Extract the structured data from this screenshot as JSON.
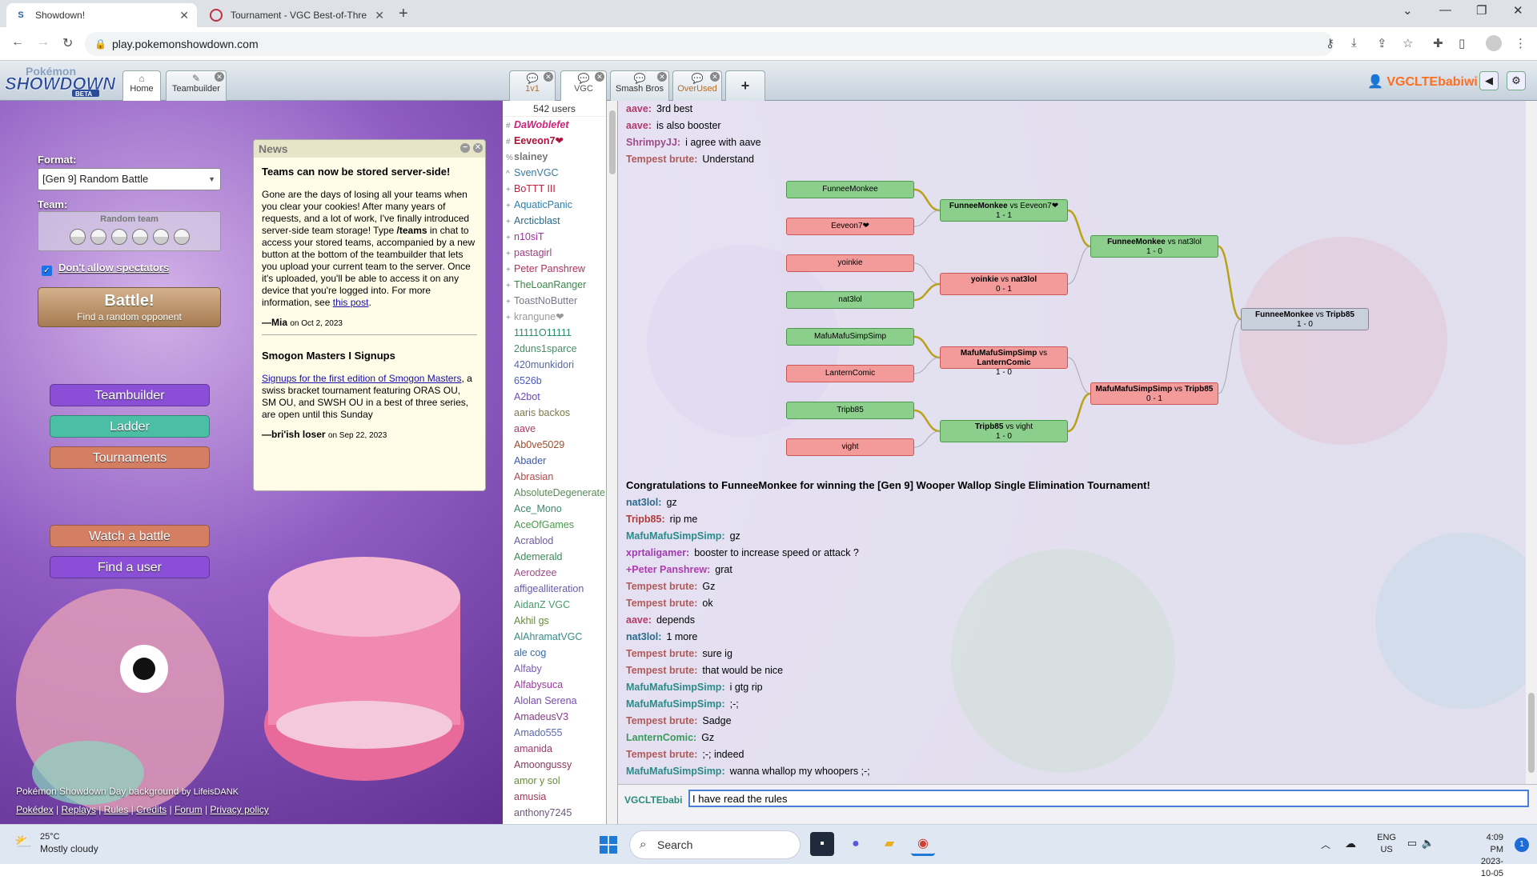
{
  "browser": {
    "tabs": [
      {
        "title": "Showdown!",
        "active": true
      },
      {
        "title": "Tournament - VGC Best-of-Three",
        "active": false
      }
    ],
    "url": "play.pokemonshowdown.com"
  },
  "header": {
    "logo_top": "Pokémon",
    "logo_main": "SHOWDOWN",
    "logo_beta": "BETA",
    "tabs": [
      {
        "label": "Home",
        "icon": "home-icon"
      },
      {
        "label": "Teambuilder",
        "icon": "pencil-icon"
      }
    ],
    "room_tabs": [
      {
        "label": "1v1"
      },
      {
        "label": "VGC"
      },
      {
        "label": "Smash Bros"
      },
      {
        "label": "OverUsed"
      }
    ],
    "add_tab": "+",
    "username": "VGCLTEbabiwi"
  },
  "mainmenu": {
    "format_label": "Format:",
    "format_value": "[Gen 9] Random Battle",
    "team_label": "Team:",
    "team_value": "Random team",
    "spectators_label": "Don't allow spectators",
    "battle_title": "Battle!",
    "battle_sub": "Find a random opponent",
    "teambuilder": "Teambuilder",
    "ladder": "Ladder",
    "tournaments": "Tournaments",
    "watch": "Watch a battle",
    "find_user": "Find a user",
    "colors": {
      "teambuilder": "#8a4fd6",
      "ladder": "#4bbfa6",
      "tournaments": "#d47e63",
      "watch": "#d47e63",
      "find_user": "#8a4fd6"
    }
  },
  "footer": {
    "credit_prefix": "Pokémon Showdown Day background",
    "credit_by": "by",
    "credit_name": "LifeisDANK",
    "links": [
      "Pokédex",
      "Replays",
      "Rules",
      "Credits",
      "Forum",
      "Privacy policy"
    ]
  },
  "news": {
    "title": "News",
    "items": [
      {
        "heading": "Teams can now be stored server-side!",
        "p1": "Gone are the days of losing all your teams when you clear your cookies! After many years of requests, and a lot of work, I've finally introduced server-side team storage! Type",
        "cmd": "/teams",
        "p2": "in chat to access your stored teams, accompanied by a new button at the bottom of the teambuilder that lets you upload your current team to the server. Once it's uploaded, you'll be able to access it on any device that you're logged into. For more information, see",
        "link": "this post",
        "author": "—Mia",
        "date": "on Oct 2, 2023"
      },
      {
        "heading": "Smogon Masters I Signups",
        "link": "Signups for the first edition of Smogon Masters",
        "p1": ", a swiss bracket tournament featuring ORAS OU, SM OU, and SWSH OU in a best of three series, are open until this Sunday",
        "author": "—bri'ish loser",
        "date": "on Sep 22, 2023"
      }
    ]
  },
  "userlist": {
    "count": "542 users",
    "users": [
      {
        "g": "#",
        "name": "DaWoblefet",
        "color": "#d0207a",
        "style": "bi"
      },
      {
        "g": "#",
        "name": "Eeveon7❤",
        "color": "#b0103a",
        "style": "b"
      },
      {
        "g": "%",
        "name": "slainey",
        "color": "#777",
        "style": "b"
      },
      {
        "g": "^",
        "name": "SvenVGC",
        "color": "#3a7aa0",
        "style": ""
      },
      {
        "g": "+",
        "name": "BoTTT III",
        "color": "#c02040",
        "style": ""
      },
      {
        "g": "+",
        "name": "AquaticPanic",
        "color": "#2a80b0",
        "style": ""
      },
      {
        "g": "+",
        "name": "Arcticblast",
        "color": "#2a6a8a",
        "style": ""
      },
      {
        "g": "+",
        "name": "n10siT",
        "color": "#a030a0",
        "style": ""
      },
      {
        "g": "+",
        "name": "pastagirl",
        "color": "#a04080",
        "style": ""
      },
      {
        "g": "+",
        "name": "Peter Panshrew",
        "color": "#b03060",
        "style": ""
      },
      {
        "g": "+",
        "name": "TheLoanRanger",
        "color": "#3a8a4a",
        "style": ""
      },
      {
        "g": "+",
        "name": "ToastNoButter",
        "color": "#778",
        "style": ""
      },
      {
        "g": "+",
        "name": "krangune❤",
        "color": "#999",
        "style": ""
      },
      {
        "g": "",
        "name": "11111O11111",
        "color": "#2a8a6a",
        "style": ""
      },
      {
        "g": "",
        "name": "2duns1sparce",
        "color": "#4a8a6a",
        "style": ""
      },
      {
        "g": "",
        "name": "420munkidori",
        "color": "#5a6aa0",
        "style": ""
      },
      {
        "g": "",
        "name": "6526b",
        "color": "#4a5ac0",
        "style": ""
      },
      {
        "g": "",
        "name": "A2bot",
        "color": "#6a4ac0",
        "style": ""
      },
      {
        "g": "",
        "name": "aaris backos",
        "color": "#7a7a4a",
        "style": ""
      },
      {
        "g": "",
        "name": "aave",
        "color": "#b03a6a",
        "style": ""
      },
      {
        "g": "",
        "name": "Ab0ve5029",
        "color": "#a04a2a",
        "style": ""
      },
      {
        "g": "",
        "name": "Abader",
        "color": "#3a5ab0",
        "style": ""
      },
      {
        "g": "",
        "name": "Abrasian",
        "color": "#b04a4a",
        "style": ""
      },
      {
        "g": "",
        "name": "AbsoluteDegenerate",
        "color": "#5a8a5a",
        "style": ""
      },
      {
        "g": "",
        "name": "Ace_Mono",
        "color": "#3a8a6a",
        "style": ""
      },
      {
        "g": "",
        "name": "AceOfGames",
        "color": "#4a9a4a",
        "style": ""
      },
      {
        "g": "",
        "name": "Acrablod",
        "color": "#6a5aa0",
        "style": ""
      },
      {
        "g": "",
        "name": "Ademerald",
        "color": "#3a8a5a",
        "style": ""
      },
      {
        "g": "",
        "name": "Aerodzee",
        "color": "#a04a8a",
        "style": ""
      },
      {
        "g": "",
        "name": "affigealliteration",
        "color": "#6a5ab0",
        "style": ""
      },
      {
        "g": "",
        "name": "AidanZ VGC",
        "color": "#4a9a6a",
        "style": ""
      },
      {
        "g": "",
        "name": "Akhil gs",
        "color": "#6a8a3a",
        "style": ""
      },
      {
        "g": "",
        "name": "AlAhramatVGC",
        "color": "#3a8a8a",
        "style": ""
      },
      {
        "g": "",
        "name": "ale cog",
        "color": "#3a6ab0",
        "style": ""
      },
      {
        "g": "",
        "name": "Alfaby",
        "color": "#7a5ab0",
        "style": ""
      },
      {
        "g": "",
        "name": "Alfabysuca",
        "color": "#9a3aa0",
        "style": ""
      },
      {
        "g": "",
        "name": "Alolan Serena",
        "color": "#7a4ab0",
        "style": ""
      },
      {
        "g": "",
        "name": "AmadeusV3",
        "color": "#8a3a8a",
        "style": ""
      },
      {
        "g": "",
        "name": "Amado555",
        "color": "#5a6ab0",
        "style": ""
      },
      {
        "g": "",
        "name": "amanida",
        "color": "#a03a6a",
        "style": ""
      },
      {
        "g": "",
        "name": "Amoongussy",
        "color": "#8a3a5a",
        "style": ""
      },
      {
        "g": "",
        "name": "amor y sol",
        "color": "#6a8a3a",
        "style": ""
      },
      {
        "g": "",
        "name": "amusia",
        "color": "#a03a5a",
        "style": ""
      },
      {
        "g": "",
        "name": "anthony7245",
        "color": "#6a5a7a",
        "style": ""
      }
    ]
  },
  "chat_top": [
    {
      "user": "aave:",
      "color": "#b03a6a",
      "msg": "3rd best"
    },
    {
      "user": "aave:",
      "color": "#b03a6a",
      "msg": "is also booster"
    },
    {
      "user": "ShrimpyJJ:",
      "color": "#a04a8a",
      "msg": "i agree with aave"
    },
    {
      "user": "Tempest brute:",
      "color": "#b05a5a",
      "msg": "Understand"
    }
  ],
  "bracket": {
    "players": [
      {
        "name": "FunneeMonkee",
        "result": "w"
      },
      {
        "name": "Eeveon7❤",
        "result": "l"
      },
      {
        "name": "yoinkie",
        "result": "l"
      },
      {
        "name": "nat3lol",
        "result": "w"
      },
      {
        "name": "MafuMafuSimpSimp",
        "result": "w"
      },
      {
        "name": "LanternComic",
        "result": "l"
      },
      {
        "name": "Tripb85",
        "result": "w"
      },
      {
        "name": "vight",
        "result": "l"
      }
    ],
    "r1": [
      {
        "a": "FunneeMonkee",
        "vs": "vs",
        "b": "Eeveon7❤",
        "score": "1 - 1",
        "result": "w"
      },
      {
        "a": "yoinkie",
        "vs": "vs",
        "b": "nat3lol",
        "score": "0 - 1",
        "result": "l"
      },
      {
        "a": "MafuMafuSimpSimp",
        "vs": "vs",
        "b": "LanternComic",
        "score": "1 - 0",
        "result": "l"
      },
      {
        "a": "Tripb85",
        "vs": "vs",
        "b": "vight",
        "score": "1 - 0",
        "result": "w"
      }
    ],
    "r2": [
      {
        "a": "FunneeMonkee",
        "vs": "vs",
        "b": "nat3lol",
        "score": "1 - 0",
        "result": "w"
      },
      {
        "a": "MafuMafuSimpSimp",
        "vs": "vs",
        "b": "Tripb85",
        "score": "0 - 1",
        "result": "l"
      }
    ],
    "final": {
      "a": "FunneeMonkee",
      "vs": "vs",
      "b": "Tripb85",
      "score": "1 - 0",
      "result": "n"
    },
    "colors": {
      "win": "#8ccf8c",
      "loss": "#f39a9a",
      "line": "#b8a21a"
    }
  },
  "congrats": "Congratulations to FunneeMonkee for winning the [Gen 9] Wooper Wallop Single Elimination Tournament!",
  "chat_bottom": [
    {
      "user": "nat3lol:",
      "color": "#2a6a8a",
      "msg": "gz"
    },
    {
      "user": "Tripb85:",
      "color": "#b03a3a",
      "msg": "rip me"
    },
    {
      "user": "MafuMafuSimpSimp:",
      "color": "#2a8a8a",
      "msg": "gz"
    },
    {
      "user": "xprtaligamer:",
      "color": "#a03ab0",
      "msg": "booster to increase speed or attack ?"
    },
    {
      "user": "+Peter Panshrew:",
      "color": "#b03ab0",
      "msg": "grat"
    },
    {
      "user": "Tempest brute:",
      "color": "#b05a5a",
      "msg": "Gz"
    },
    {
      "user": "Tempest brute:",
      "color": "#b05a5a",
      "msg": "ok"
    },
    {
      "user": "aave:",
      "color": "#b03a6a",
      "msg": "depends"
    },
    {
      "user": "nat3lol:",
      "color": "#2a6a8a",
      "msg": "1 more"
    },
    {
      "user": "Tempest brute:",
      "color": "#b05a5a",
      "msg": "sure ig"
    },
    {
      "user": "Tempest brute:",
      "color": "#b05a5a",
      "msg": "that would be nice"
    },
    {
      "user": "MafuMafuSimpSimp:",
      "color": "#2a8a8a",
      "msg": "i gtg rip"
    },
    {
      "user": "MafuMafuSimpSimp:",
      "color": "#2a8a8a",
      "msg": ";-;"
    },
    {
      "user": "Tempest brute:",
      "color": "#b05a5a",
      "msg": "Sadge"
    },
    {
      "user": "LanternComic:",
      "color": "#3a9a5a",
      "msg": "Gz"
    },
    {
      "user": "Tempest brute:",
      "color": "#b05a5a",
      "msg": ";-; indeed"
    },
    {
      "user": "MafuMafuSimpSimp:",
      "color": "#2a8a8a",
      "msg": "wanna whallop my whoopers ;-;"
    }
  ],
  "input": {
    "name": "VGCLTEbabi",
    "value": "I have read the rules"
  },
  "taskbar": {
    "temp": "25°C",
    "weather": "Mostly cloudy",
    "search": "Search",
    "lang1": "ENG",
    "lang2": "US",
    "time": "4:09 PM",
    "date": "2023-10-05",
    "badge": "1"
  }
}
